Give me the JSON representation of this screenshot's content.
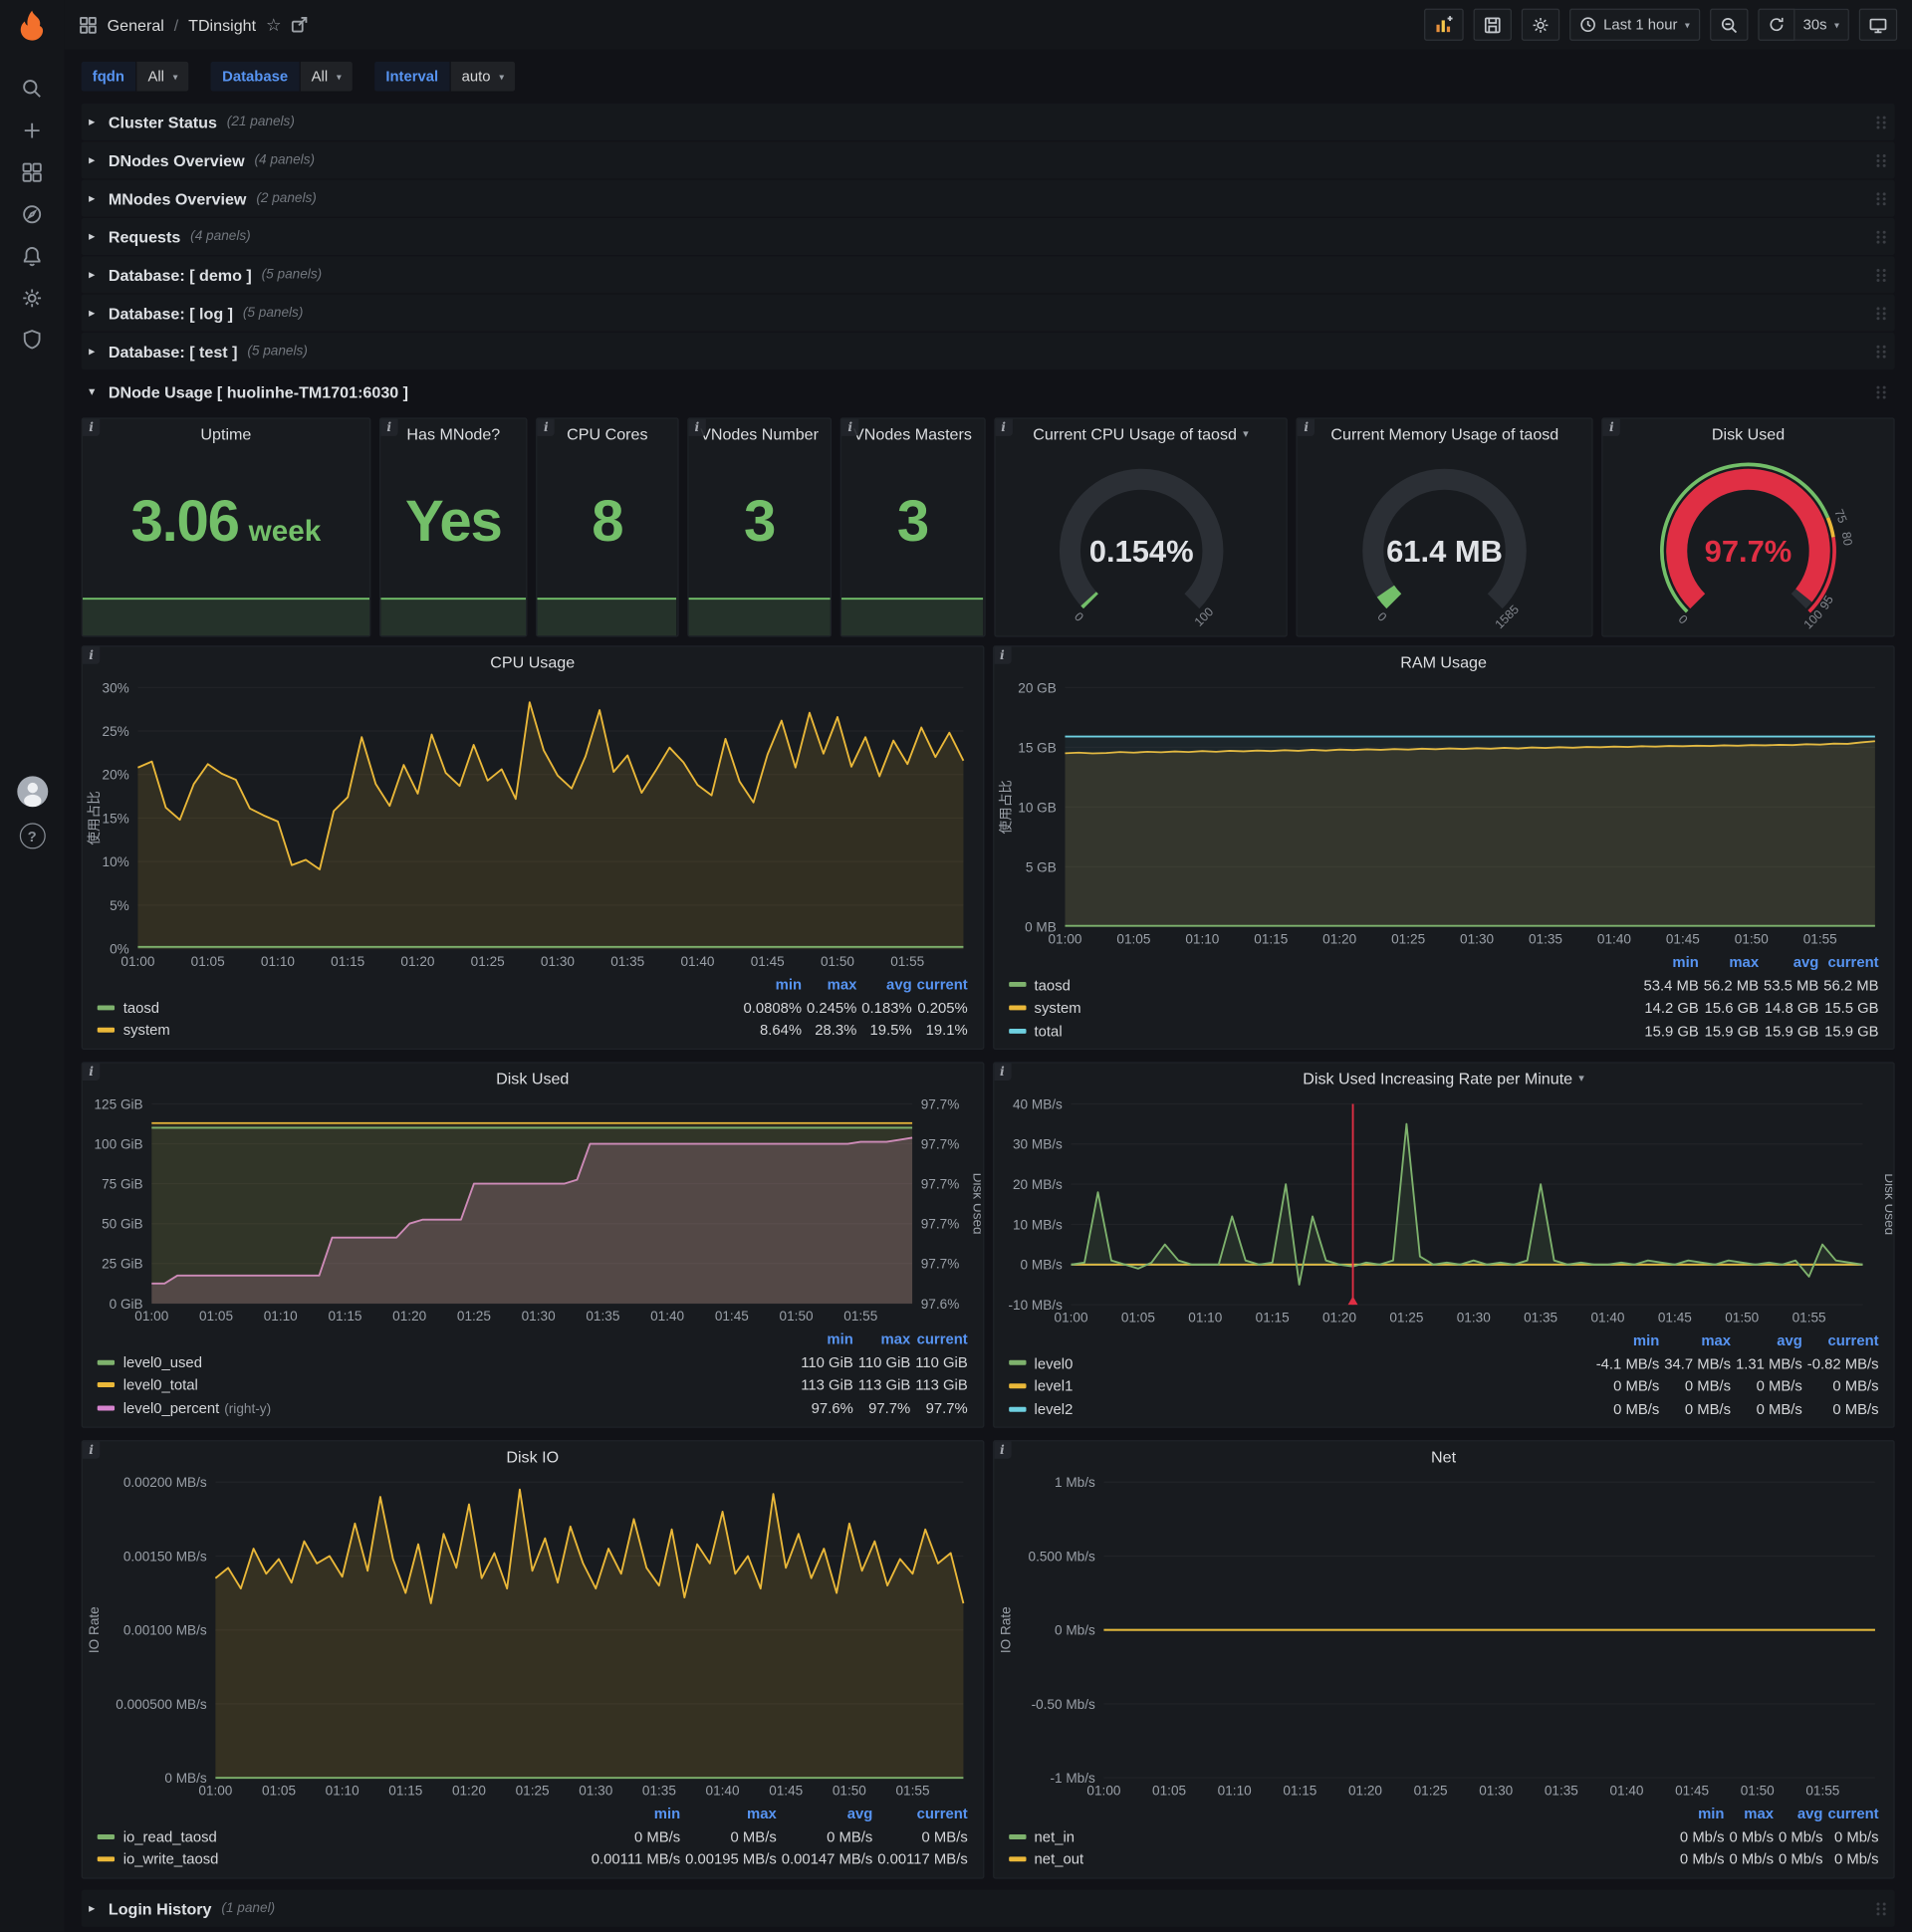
{
  "colors": {
    "green": "#7eb26d",
    "yellow": "#eab839",
    "cyan": "#6ed0e0",
    "pink": "#d683ce",
    "red": "#e02f44",
    "stat_green": "#73bf69",
    "legend_header": "#5794f2",
    "logo_orange": "#f3702c"
  },
  "nav": {
    "section": "General",
    "separator": "/",
    "title": "TDinsight",
    "time_range": "Last 1 hour",
    "refresh": "30s"
  },
  "sidebar": {
    "icons": [
      "search",
      "add",
      "dashboards",
      "explore",
      "alerting",
      "configuration",
      "server-admin"
    ]
  },
  "variables": [
    {
      "label": "fqdn",
      "value": "All"
    },
    {
      "label": "Database",
      "value": "All"
    },
    {
      "label": "Interval",
      "value": "auto"
    }
  ],
  "rows_top": [
    {
      "title": "Cluster Status",
      "count": "(21 panels)"
    },
    {
      "title": "DNodes Overview",
      "count": "(4 panels)"
    },
    {
      "title": "MNodes Overview",
      "count": "(2 panels)"
    },
    {
      "title": "Requests",
      "count": "(4 panels)"
    },
    {
      "title": "Database: [ demo ]",
      "count": "(5 panels)"
    },
    {
      "title": "Database: [ log ]",
      "count": "(5 panels)"
    },
    {
      "title": "Database: [ test ]",
      "count": "(5 panels)"
    }
  ],
  "expanded_row": {
    "title": "DNode Usage [ huolinhe-TM1701:6030 ]"
  },
  "bottom_row": {
    "title": "Login History",
    "count": "(1 panel)"
  },
  "stats": [
    {
      "title": "Uptime",
      "value": "3.06",
      "unit": "week"
    },
    {
      "title": "Has MNode?",
      "value": "Yes",
      "unit": ""
    },
    {
      "title": "CPU Cores",
      "value": "8",
      "unit": ""
    },
    {
      "title": "VNodes Number",
      "value": "3",
      "unit": ""
    },
    {
      "title": "VNodes Masters",
      "value": "3",
      "unit": ""
    }
  ],
  "gauges": [
    {
      "title": "Current CPU Usage of taosd",
      "menu": true,
      "value": "0.154%",
      "fraction": 0.00154,
      "arc_color": "#73bf69",
      "value_color": "#e0e2e6",
      "labels": [
        {
          "text": "0",
          "t": 0
        },
        {
          "text": "100",
          "t": 1
        }
      ]
    },
    {
      "title": "Current Memory Usage of taosd",
      "menu": false,
      "value": "61.4 MB",
      "fraction": 0.0387,
      "arc_color": "#73bf69",
      "value_color": "#e0e2e6",
      "labels": [
        {
          "text": "0",
          "t": 0
        },
        {
          "text": "1585",
          "t": 1
        }
      ]
    },
    {
      "title": "Disk Used",
      "menu": false,
      "value": "97.7%",
      "fraction": 0.977,
      "arc_color": "#e02f44",
      "value_color": "#e02f44",
      "thresholds": [
        {
          "color": "#73bf69",
          "from": 0,
          "to": 0.75
        },
        {
          "color": "#eab839",
          "from": 0.75,
          "to": 0.8
        },
        {
          "color": "#e02f44",
          "from": 0.8,
          "to": 1
        }
      ],
      "labels": [
        {
          "text": "0",
          "t": 0
        },
        {
          "text": "75",
          "t": 0.75
        },
        {
          "text": "80",
          "t": 0.8
        },
        {
          "text": "95",
          "t": 0.95
        },
        {
          "text": "100",
          "t": 1
        }
      ]
    }
  ],
  "x_ticks": [
    "01:00",
    "01:05",
    "01:10",
    "01:15",
    "01:20",
    "01:25",
    "01:30",
    "01:35",
    "01:40",
    "01:45",
    "01:50",
    "01:55"
  ],
  "chart_data": [
    {
      "type": "line",
      "title": "CPU Usage",
      "menu": false,
      "ylabel": "使用占比",
      "y_ticks": [
        "0%",
        "5%",
        "10%",
        "15%",
        "20%",
        "25%",
        "30%"
      ],
      "ymin": 0,
      "ymax": 30,
      "series": [
        {
          "name": "system",
          "color": "yellow",
          "fill": 0.13,
          "values": [
            20.8,
            21.5,
            16.2,
            14.8,
            18.9,
            21.2,
            20.1,
            19.4,
            16.1,
            15.3,
            14.6,
            9.6,
            10.2,
            9.1,
            15.8,
            17.4,
            24.3,
            18.9,
            16.4,
            21.1,
            17.8,
            24.6,
            20.2,
            18.7,
            23.4,
            19.3,
            20.6,
            17.2,
            28.3,
            22.8,
            19.9,
            18.4,
            22.1,
            27.4,
            20.3,
            22.2,
            17.9,
            20.4,
            23.1,
            21.4,
            18.8,
            17.6,
            24.1,
            19.2,
            16.8,
            22.3,
            26.2,
            20.8,
            27.1,
            22.4,
            26.6,
            20.9,
            24.3,
            19.8,
            23.9,
            21.2,
            25.4,
            22.0,
            24.8,
            21.6
          ]
        },
        {
          "name": "taosd",
          "color": "green",
          "fill": 0.1,
          "values": [
            0.2,
            0.2
          ]
        }
      ],
      "legend": {
        "columns": [
          "min",
          "max",
          "avg",
          "current"
        ],
        "rows": [
          {
            "name": "taosd",
            "color": "green",
            "values": [
              "0.0808%",
              "0.245%",
              "0.183%",
              "0.205%"
            ]
          },
          {
            "name": "system",
            "color": "yellow",
            "values": [
              "8.64%",
              "28.3%",
              "19.5%",
              "19.1%"
            ]
          }
        ]
      }
    },
    {
      "type": "line",
      "title": "RAM Usage",
      "menu": false,
      "ylabel": "使用占比",
      "y_ticks": [
        "0 MB",
        "5 GB",
        "10 GB",
        "15 GB",
        "20 GB"
      ],
      "ymin": 0,
      "ymax": 20,
      "series": [
        {
          "name": "system",
          "color": "yellow",
          "fill": 0.12,
          "values": [
            14.5,
            14.55,
            14.48,
            14.52,
            14.6,
            14.55,
            14.62,
            14.58,
            14.65,
            14.6,
            14.68,
            14.62,
            14.7,
            14.66,
            14.72,
            14.68,
            14.75,
            14.7,
            14.78,
            14.72,
            14.8,
            14.76,
            14.82,
            14.78,
            14.85,
            14.8,
            14.88,
            14.84,
            14.9,
            14.86,
            14.92,
            14.88,
            14.95,
            14.9,
            14.98,
            14.94,
            15.0,
            14.96,
            15.02,
            15.0,
            15.05,
            15.02,
            15.08,
            15.05,
            15.1,
            15.08,
            15.12,
            15.1,
            15.15,
            15.12,
            15.18,
            15.15,
            15.2,
            15.18,
            15.25,
            15.22,
            15.3,
            15.28,
            15.4,
            15.5
          ]
        },
        {
          "name": "total",
          "color": "cyan",
          "fill": 0.06,
          "values": [
            15.9,
            15.9
          ]
        },
        {
          "name": "taosd",
          "color": "green",
          "fill": 0.1,
          "values": [
            0.055,
            0.055
          ]
        }
      ],
      "legend": {
        "columns": [
          "min",
          "max",
          "avg",
          "current"
        ],
        "rows": [
          {
            "name": "taosd",
            "color": "green",
            "values": [
              "53.4 MB",
              "56.2 MB",
              "53.5 MB",
              "56.2 MB"
            ]
          },
          {
            "name": "system",
            "color": "yellow",
            "values": [
              "14.2 GB",
              "15.6 GB",
              "14.8 GB",
              "15.5 GB"
            ]
          },
          {
            "name": "total",
            "color": "cyan",
            "values": [
              "15.9 GB",
              "15.9 GB",
              "15.9 GB",
              "15.9 GB"
            ]
          }
        ]
      }
    },
    {
      "type": "line",
      "title": "Disk Used",
      "menu": false,
      "y_ticks": [
        "0 GiB",
        "25 GiB",
        "50 GiB",
        "75 GiB",
        "100 GiB",
        "125 GiB"
      ],
      "right_ticks": [
        "97.6%",
        "97.7%",
        "97.7%",
        "97.7%",
        "97.7%",
        "97.7%"
      ],
      "right_label": "Disk Used",
      "ymin": 0,
      "ymax": 125,
      "series": [
        {
          "name": "level0_percent",
          "color": "pink",
          "fill": 0.22,
          "frac": true,
          "values": [
            0.1,
            0.1,
            0.14,
            0.14,
            0.14,
            0.14,
            0.14,
            0.14,
            0.14,
            0.14,
            0.14,
            0.14,
            0.14,
            0.14,
            0.33,
            0.33,
            0.33,
            0.33,
            0.33,
            0.33,
            0.4,
            0.42,
            0.42,
            0.42,
            0.42,
            0.6,
            0.6,
            0.6,
            0.6,
            0.6,
            0.6,
            0.6,
            0.6,
            0.62,
            0.8,
            0.8,
            0.8,
            0.8,
            0.8,
            0.8,
            0.8,
            0.8,
            0.8,
            0.8,
            0.8,
            0.8,
            0.8,
            0.8,
            0.8,
            0.8,
            0.8,
            0.8,
            0.8,
            0.8,
            0.8,
            0.81,
            0.81,
            0.81,
            0.82,
            0.83
          ]
        },
        {
          "name": "level0_total",
          "color": "yellow",
          "fill": 0.09,
          "values": [
            113,
            113
          ]
        },
        {
          "name": "level0_used",
          "color": "green",
          "fill": 0.09,
          "values": [
            110,
            110
          ]
        }
      ],
      "legend": {
        "columns": [
          "min",
          "max",
          "current"
        ],
        "rows": [
          {
            "name": "level0_used",
            "color": "green",
            "values": [
              "110 GiB",
              "110 GiB",
              "110 GiB"
            ]
          },
          {
            "name": "level0_total",
            "color": "yellow",
            "values": [
              "113 GiB",
              "113 GiB",
              "113 GiB"
            ]
          },
          {
            "name": "level0_percent",
            "color": "pink",
            "suffix": "(right-y)",
            "values": [
              "97.6%",
              "97.7%",
              "97.7%"
            ]
          }
        ]
      }
    },
    {
      "type": "line",
      "title": "Disk Used Increasing Rate per Minute",
      "menu": true,
      "y_ticks": [
        "-10 MB/s",
        "0 MB/s",
        "10 MB/s",
        "20 MB/s",
        "30 MB/s",
        "40 MB/s"
      ],
      "right_label": "Disk Used",
      "ymin": -10,
      "ymax": 40,
      "annotation_x": 0.356,
      "series": [
        {
          "name": "level2",
          "color": "cyan",
          "fill": 0,
          "values": [
            0,
            0
          ]
        },
        {
          "name": "level1",
          "color": "yellow",
          "fill": 0,
          "values": [
            0,
            0
          ]
        },
        {
          "name": "level0",
          "color": "green",
          "fill": 0.12,
          "values": [
            0,
            0.5,
            18,
            1,
            0,
            -1,
            0.5,
            5,
            1,
            0,
            0,
            0,
            12,
            1,
            0,
            0.5,
            20,
            -5,
            12,
            1,
            0,
            -0.5,
            0.5,
            0,
            1,
            35,
            2,
            0,
            0.5,
            0,
            1,
            0,
            0.5,
            0,
            1,
            20,
            1,
            0,
            0.5,
            0,
            0,
            0.5,
            0,
            1,
            0.5,
            0,
            1,
            0.5,
            0,
            1,
            0.5,
            0,
            0.5,
            0,
            1,
            -3,
            5,
            1,
            0.5,
            0
          ]
        }
      ],
      "legend": {
        "columns": [
          "min",
          "max",
          "avg",
          "current"
        ],
        "rows": [
          {
            "name": "level0",
            "color": "green",
            "values": [
              "-4.1 MB/s",
              "34.7 MB/s",
              "1.31 MB/s",
              "-0.82 MB/s"
            ]
          },
          {
            "name": "level1",
            "color": "yellow",
            "values": [
              "0 MB/s",
              "0 MB/s",
              "0 MB/s",
              "0 MB/s"
            ]
          },
          {
            "name": "level2",
            "color": "cyan",
            "values": [
              "0 MB/s",
              "0 MB/s",
              "0 MB/s",
              "0 MB/s"
            ]
          }
        ]
      }
    },
    {
      "type": "line",
      "title": "Disk IO",
      "menu": false,
      "ylabel": "IO Rate",
      "y_ticks": [
        "0 MB/s",
        "0.000500 MB/s",
        "0.00100 MB/s",
        "0.00150 MB/s",
        "0.00200 MB/s"
      ],
      "ymin": 0,
      "ymax": 0.002,
      "series": [
        {
          "name": "io_write_taosd",
          "color": "yellow",
          "fill": 0.14,
          "values": [
            0.00135,
            0.00142,
            0.00128,
            0.00155,
            0.00138,
            0.00148,
            0.00132,
            0.0016,
            0.00145,
            0.0015,
            0.00136,
            0.00172,
            0.0014,
            0.0019,
            0.00148,
            0.00125,
            0.00158,
            0.00118,
            0.00165,
            0.00142,
            0.00185,
            0.00135,
            0.00152,
            0.00128,
            0.00195,
            0.0014,
            0.00162,
            0.00132,
            0.0017,
            0.00145,
            0.00128,
            0.00155,
            0.00138,
            0.00175,
            0.00142,
            0.0013,
            0.00168,
            0.00122,
            0.00158,
            0.00145,
            0.0018,
            0.00138,
            0.0015,
            0.00128,
            0.00192,
            0.00142,
            0.00165,
            0.00135,
            0.00155,
            0.00125,
            0.00172,
            0.0014,
            0.0016,
            0.0013,
            0.00148,
            0.00138,
            0.00168,
            0.00145,
            0.00152,
            0.00118
          ]
        },
        {
          "name": "io_read_taosd",
          "color": "green",
          "fill": 0.1,
          "values": [
            0,
            0
          ]
        }
      ],
      "legend": {
        "columns": [
          "min",
          "max",
          "avg",
          "current"
        ],
        "rows": [
          {
            "name": "io_read_taosd",
            "color": "green",
            "values": [
              "0 MB/s",
              "0 MB/s",
              "0 MB/s",
              "0 MB/s"
            ]
          },
          {
            "name": "io_write_taosd",
            "color": "yellow",
            "values": [
              "0.00111 MB/s",
              "0.00195 MB/s",
              "0.00147 MB/s",
              "0.00117 MB/s"
            ]
          }
        ]
      }
    },
    {
      "type": "line",
      "title": "Net",
      "menu": false,
      "ylabel": "IO Rate",
      "y_ticks": [
        "-1 Mb/s",
        "-0.50 Mb/s",
        "0 Mb/s",
        "0.500 Mb/s",
        "1 Mb/s"
      ],
      "ymin": -1,
      "ymax": 1,
      "series": [
        {
          "name": "net_in",
          "color": "green",
          "fill": 0,
          "values": [
            0,
            0
          ]
        },
        {
          "name": "net_out",
          "color": "yellow",
          "fill": 0,
          "values": [
            0,
            0
          ]
        }
      ],
      "legend": {
        "columns": [
          "min",
          "max",
          "avg",
          "current"
        ],
        "rows": [
          {
            "name": "net_in",
            "color": "green",
            "values": [
              "0 Mb/s",
              "0 Mb/s",
              "0 Mb/s",
              "0 Mb/s"
            ]
          },
          {
            "name": "net_out",
            "color": "yellow",
            "values": [
              "0 Mb/s",
              "0 Mb/s",
              "0 Mb/s",
              "0 Mb/s"
            ]
          }
        ]
      }
    }
  ]
}
